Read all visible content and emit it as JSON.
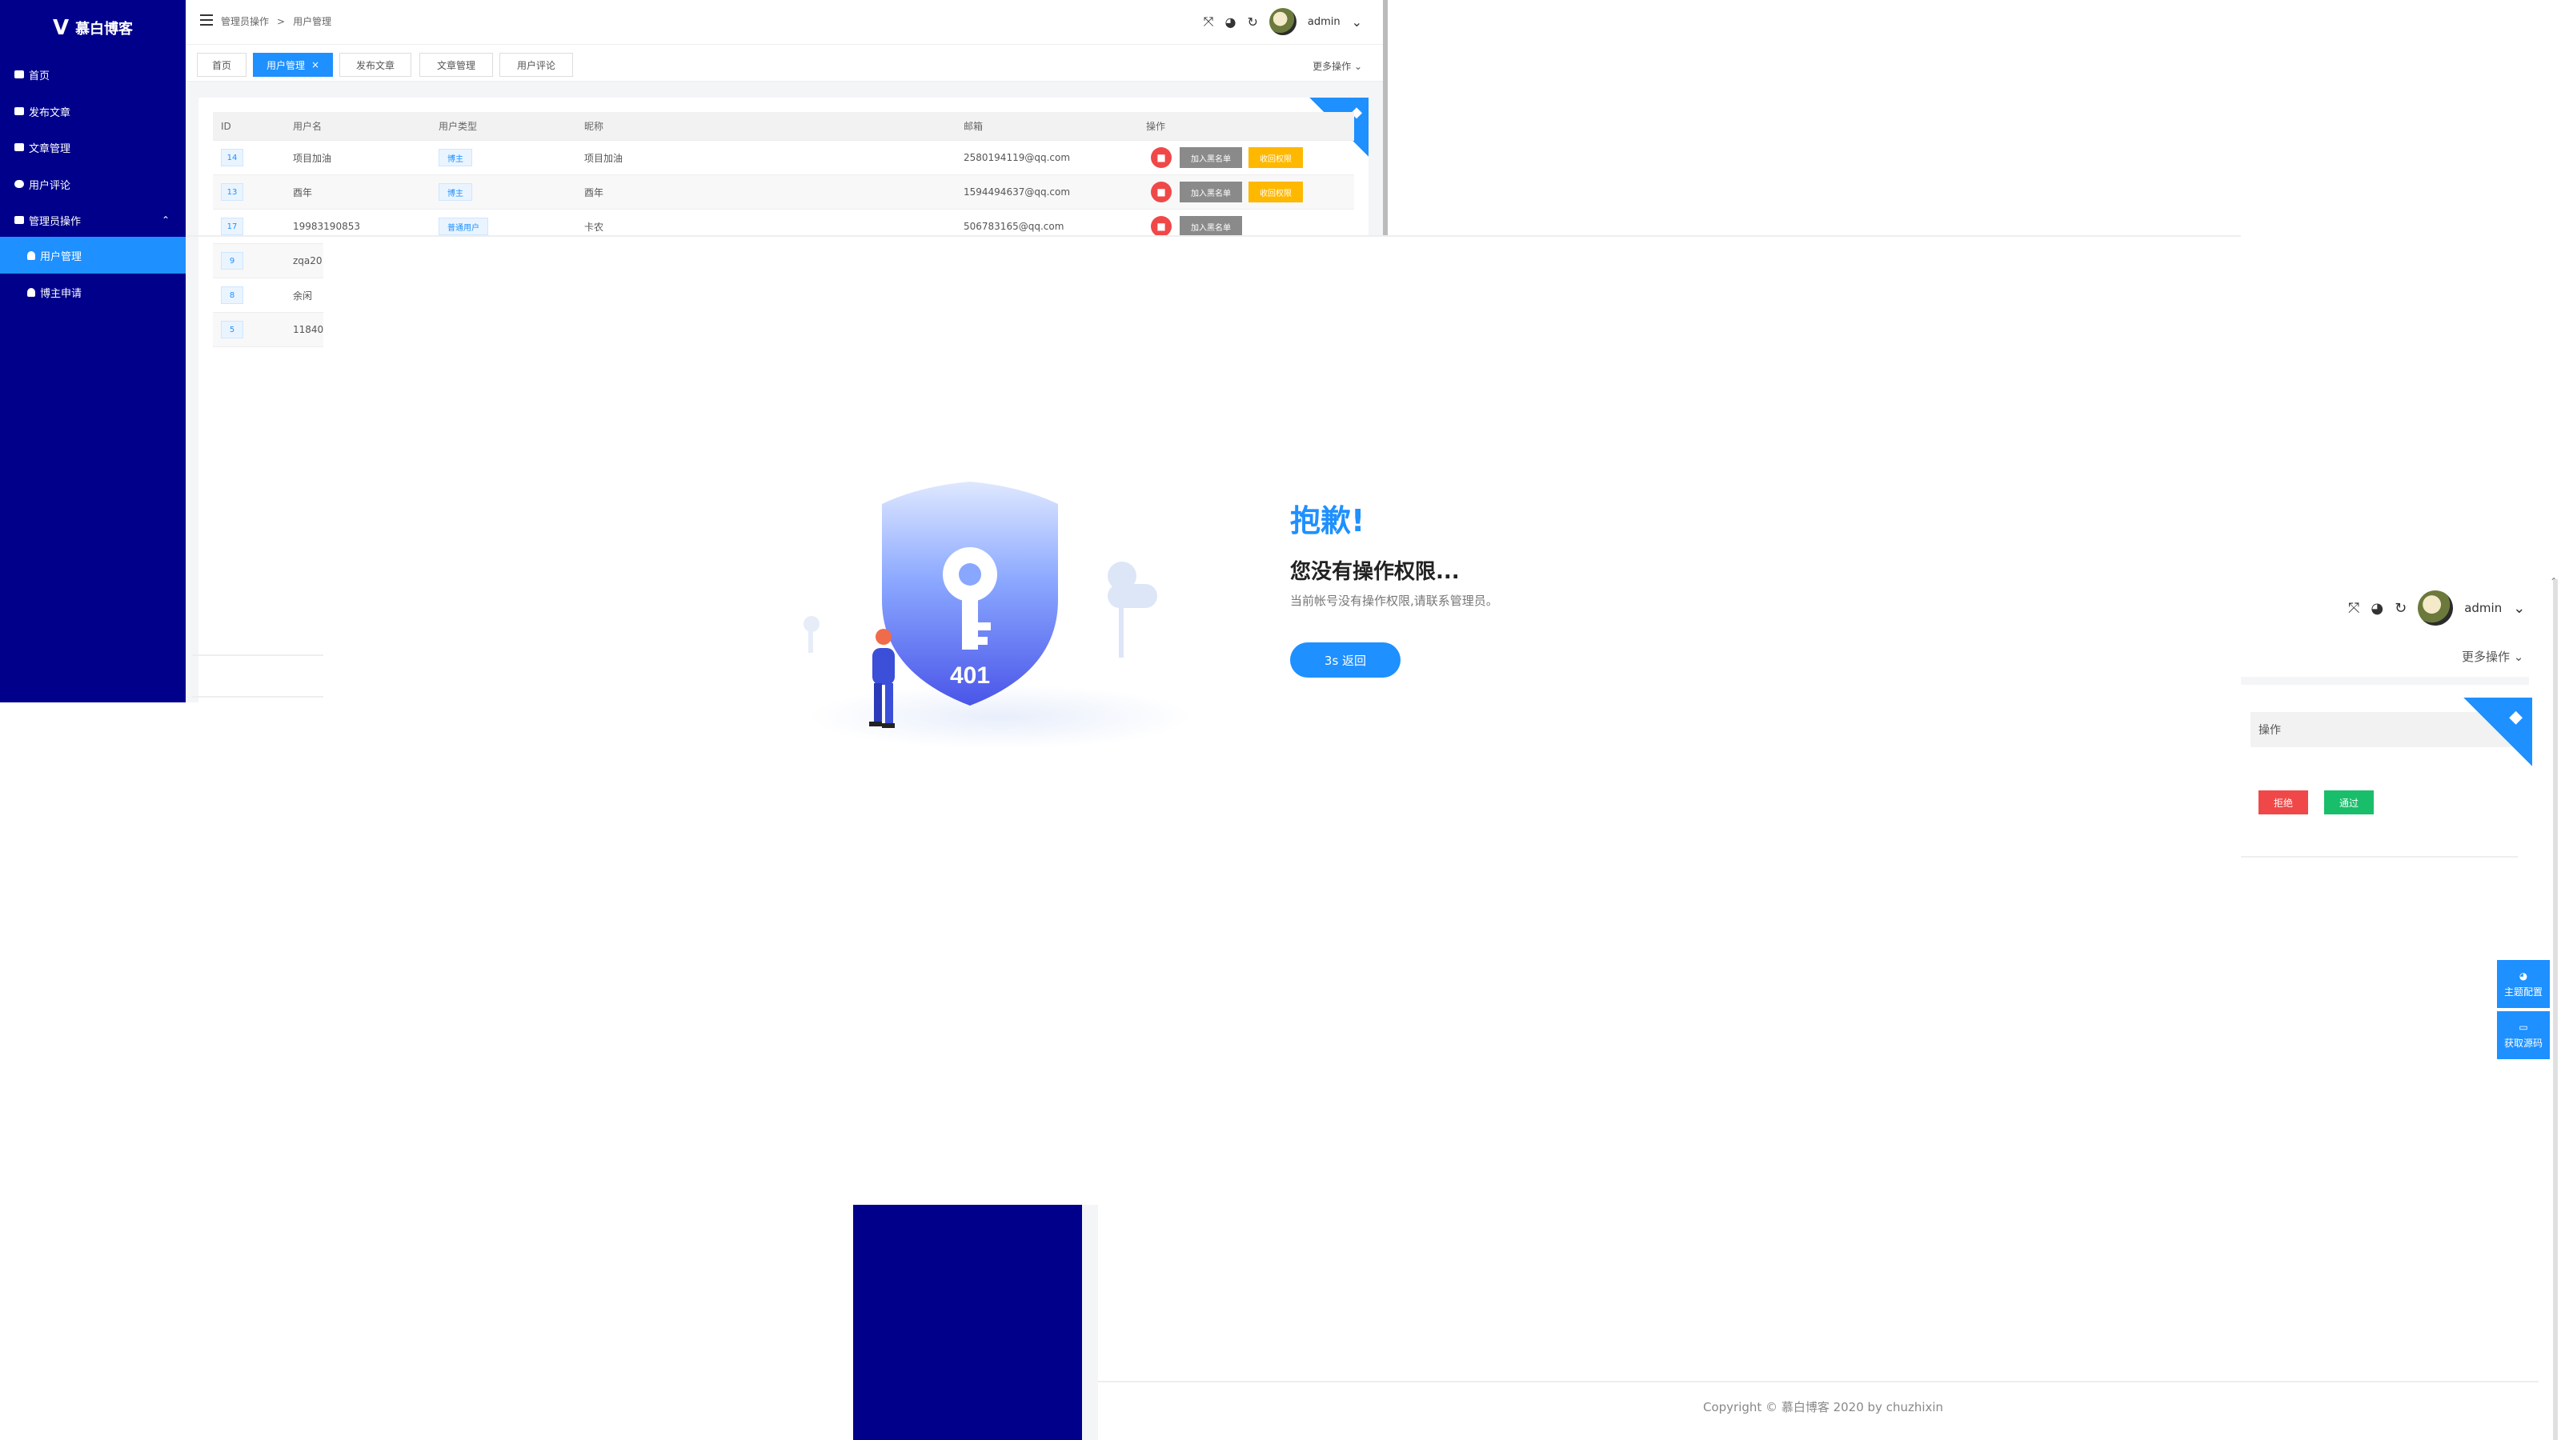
{
  "brand": {
    "logo_mark": "V",
    "name": "慕白博客"
  },
  "sidebar": {
    "items": [
      {
        "label": "首页",
        "icon": "home-icon"
      },
      {
        "label": "发布文章",
        "icon": "edit-icon"
      },
      {
        "label": "文章管理",
        "icon": "list-icon"
      },
      {
        "label": "用户评论",
        "icon": "comment-icon"
      },
      {
        "label": "管理员操作",
        "icon": "admin-icon",
        "expanded": true
      },
      {
        "label": "用户管理",
        "icon": "user-icon",
        "active": true
      },
      {
        "label": "博主申请",
        "icon": "user-icon"
      }
    ]
  },
  "header": {
    "breadcrumb": [
      "管理员操作",
      "用户管理"
    ],
    "user": "admin"
  },
  "tabs": {
    "items": [
      {
        "label": "首页"
      },
      {
        "label": "用户管理",
        "active": true,
        "close": "×"
      },
      {
        "label": "发布文章"
      },
      {
        "label": "文章管理"
      },
      {
        "label": "用户评论"
      }
    ],
    "more": "更多操作"
  },
  "table": {
    "columns": [
      "ID",
      "用户名",
      "用户类型",
      "昵称",
      "邮箱",
      "操作"
    ],
    "rows": [
      {
        "id": "14",
        "username": "项目加油",
        "type": "博主",
        "nickname": "项目加油",
        "email": "2580194119@qq.com",
        "btn_black": "加入黑名单",
        "btn_revoke": "收回权限"
      },
      {
        "id": "13",
        "username": "酉年",
        "type": "博主",
        "nickname": "酉年",
        "email": "1594494637@qq.com",
        "btn_black": "加入黑名单",
        "btn_revoke": "收回权限"
      },
      {
        "id": "17",
        "username": "19983190853",
        "type": "普通用户",
        "nickname": "卡农",
        "email": "506783165@qq.com",
        "btn_black": "加入黑名单"
      },
      {
        "id": "9",
        "username": "zqa20"
      },
      {
        "id": "8",
        "username": "余闲"
      },
      {
        "id": "5",
        "username": "11840"
      }
    ]
  },
  "error": {
    "code": "401",
    "title": "抱歉!",
    "subtitle": "您没有操作权限...",
    "desc": "当前帐号没有操作权限,请联系管理员。",
    "back_button": "3s 返回"
  },
  "right_fragment": {
    "user": "admin",
    "more": "更多操作",
    "column": "操作",
    "reject": "拒绝",
    "pass": "通过"
  },
  "float_buttons": {
    "theme": "主题配置",
    "source": "获取源码"
  },
  "footer": {
    "copyright": "Copyright © 慕白博客 2020 by chuzhixin"
  },
  "colors": {
    "sidebar": "#00008b",
    "accent": "#1e90ff",
    "danger": "#f04848",
    "warning": "#ffb800",
    "success": "#19be6b"
  }
}
